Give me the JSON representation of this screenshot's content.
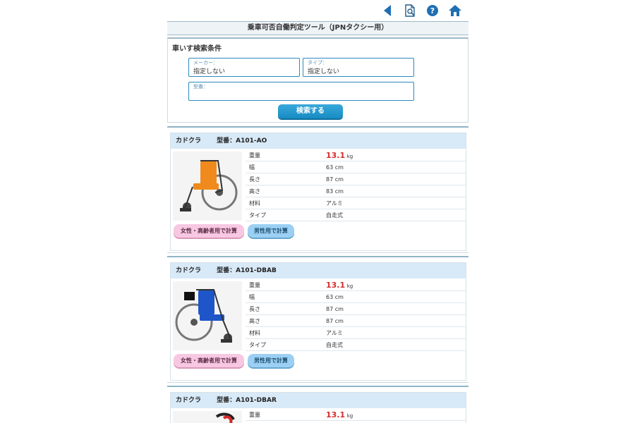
{
  "app": {
    "title": "乗車可否自働判定ツール（JPNタクシー用）"
  },
  "nav": {
    "icons": [
      {
        "name": "back-icon"
      },
      {
        "name": "document-search-icon"
      },
      {
        "name": "help-icon"
      },
      {
        "name": "home-icon"
      }
    ]
  },
  "search": {
    "title": "車いす検索条件",
    "maker": {
      "label": "メーカー：",
      "value": "指定しない"
    },
    "type": {
      "label": "タイプ：",
      "value": "指定しない"
    },
    "model": {
      "label": "型番：",
      "value": ""
    },
    "button": "検索する"
  },
  "cards": [
    {
      "maker": "カドクラ",
      "model": "型番：A101-AO",
      "image_name": "orange-wheelchair-image",
      "specs": [
        {
          "label": "重量",
          "value": "13.1",
          "unit": "kg"
        },
        {
          "label": "幅",
          "value": "63 cm"
        },
        {
          "label": "長さ",
          "value": "87 cm"
        },
        {
          "label": "高さ",
          "value": "83 cm"
        },
        {
          "label": "材料",
          "value": "アルミ"
        },
        {
          "label": "タイプ",
          "value": "自走式"
        }
      ],
      "button_female": "女性・高齢者用で計算",
      "button_male": "男性用で計算"
    },
    {
      "maker": "カドクラ",
      "model": "型番：A101-DBAB",
      "image_name": "blue-wheelchair-image",
      "specs": [
        {
          "label": "重量",
          "value": "13.1",
          "unit": "kg"
        },
        {
          "label": "幅",
          "value": "63 cm"
        },
        {
          "label": "長さ",
          "value": "87 cm"
        },
        {
          "label": "高さ",
          "value": "87 cm"
        },
        {
          "label": "材料",
          "value": "アルミ"
        },
        {
          "label": "タイプ",
          "value": "自走式"
        }
      ],
      "button_female": "女性・高齢者用で計算",
      "button_male": "男性用で計算"
    },
    {
      "maker": "カドクラ",
      "model": "型番：A101-DBAR",
      "image_name": "red-wheelchair-image",
      "specs": [
        {
          "label": "重量",
          "value": "13.1",
          "unit": "kg"
        }
      ]
    }
  ],
  "colors": {
    "accent": "#178bc3",
    "weight": "#d62b2b",
    "card_header": "#d8e9f7",
    "female_button": "#f8c7e1",
    "male_button": "#9bd0f4"
  }
}
